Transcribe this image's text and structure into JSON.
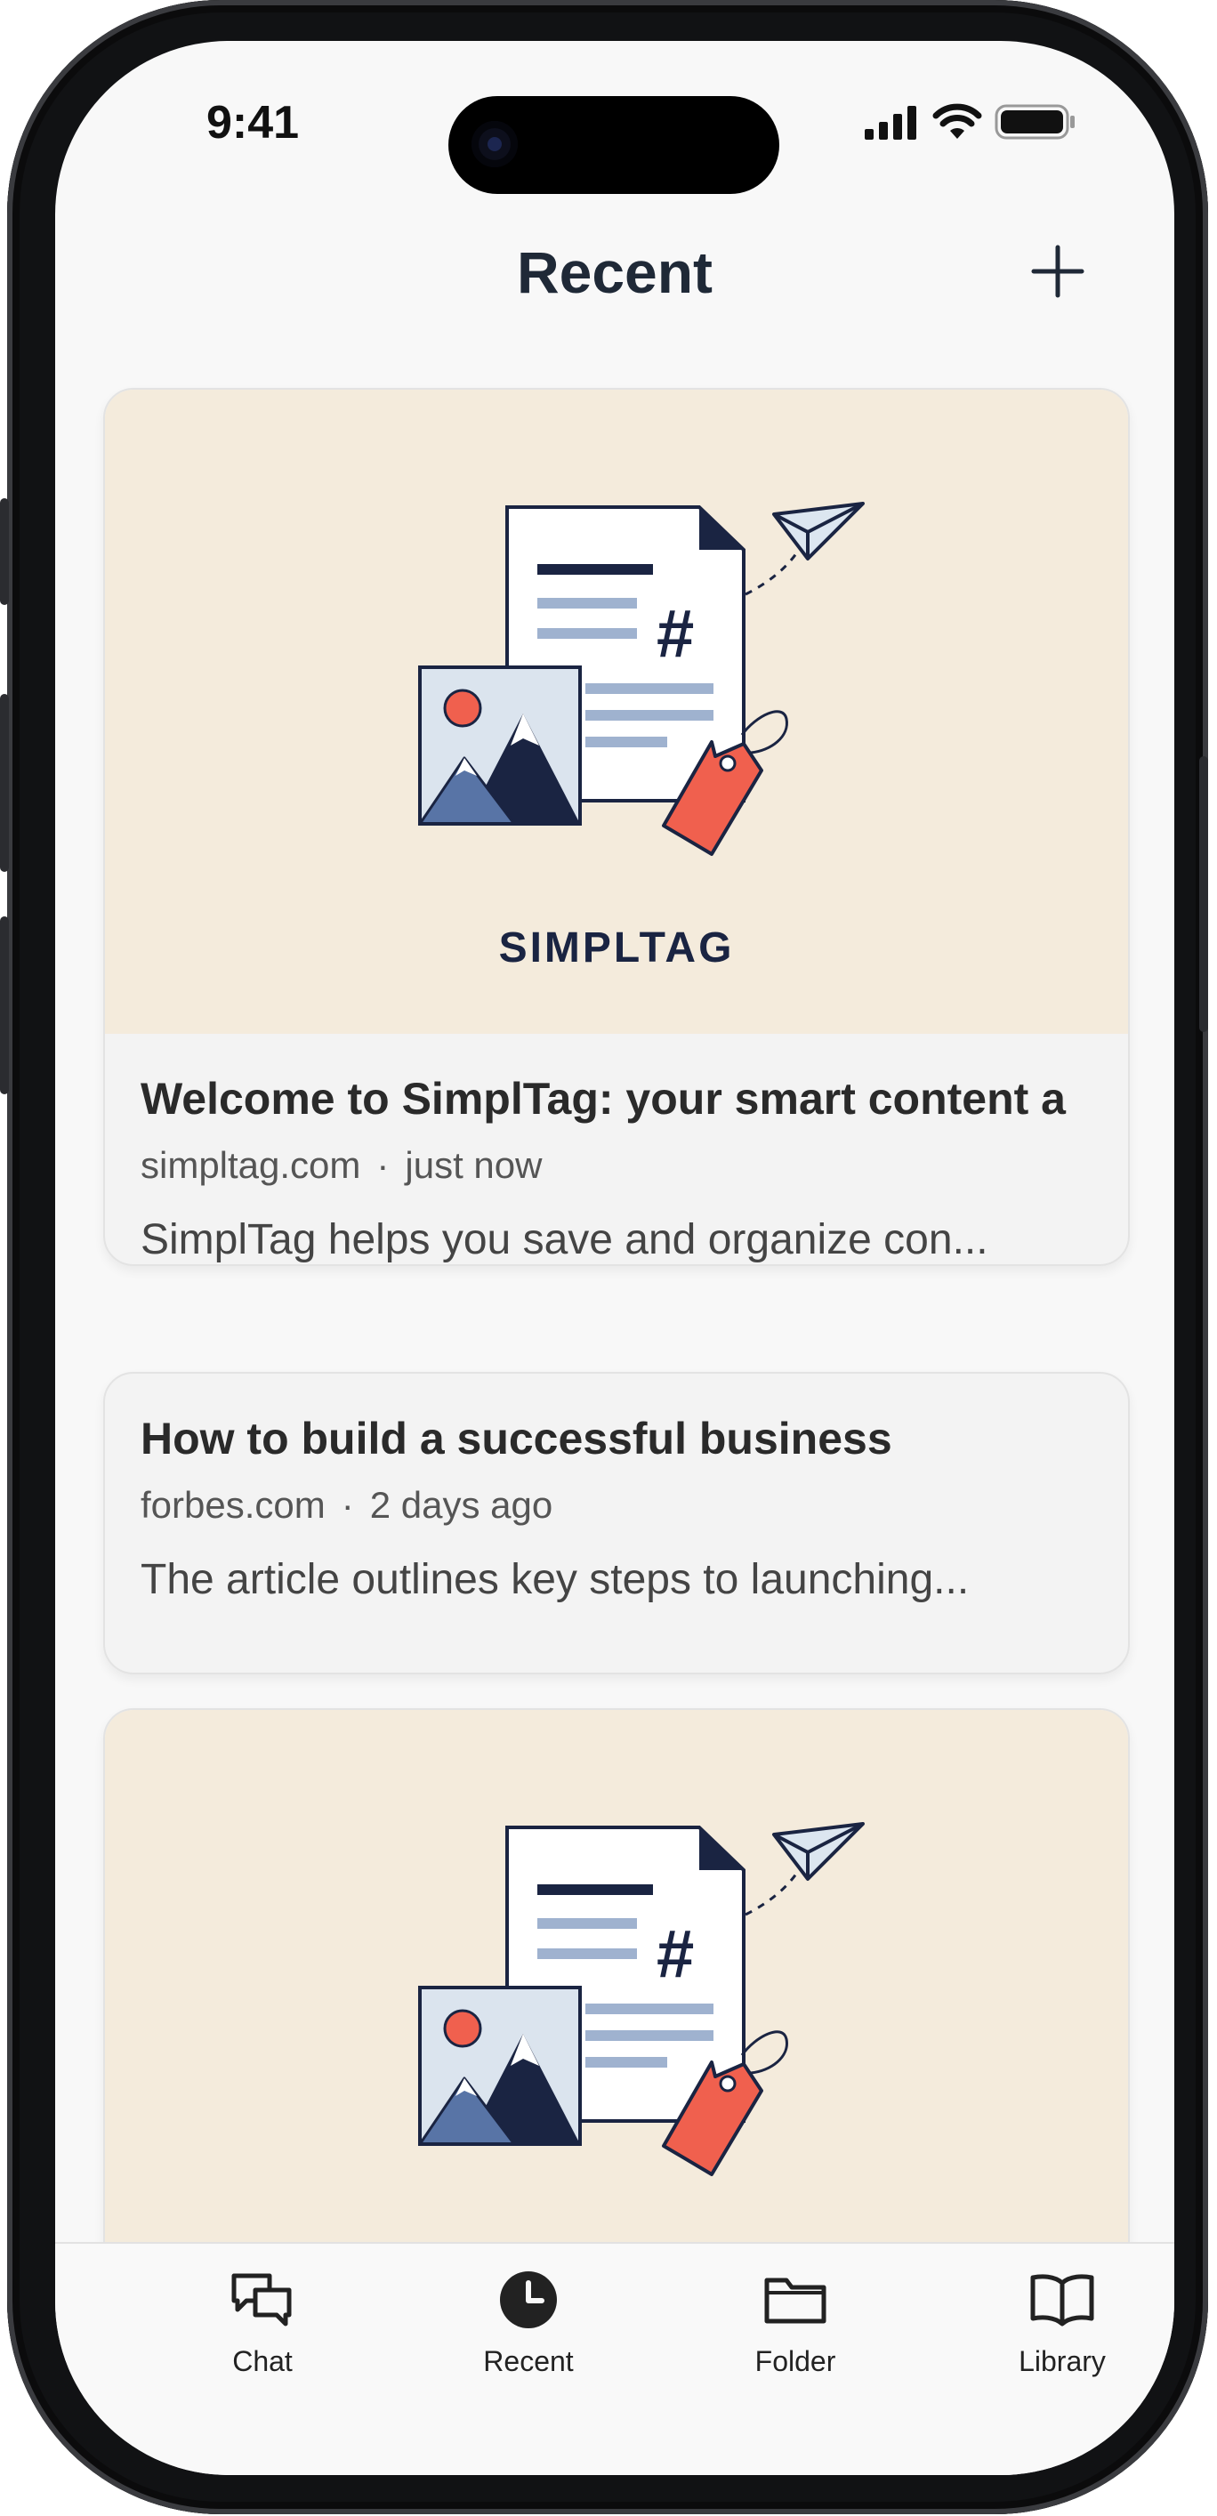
{
  "status_bar": {
    "time": "9:41"
  },
  "header": {
    "title": "Recent",
    "add_icon": "plus-icon"
  },
  "cards": [
    {
      "has_image": true,
      "image_logo_text": "SIMPLTAG",
      "title": "Welcome to SimplTag: your smart content a",
      "source": "simpltag.com",
      "separator": "·",
      "time": "just now",
      "summary": "SimplTag helps you save and organize con..."
    },
    {
      "has_image": false,
      "title": "How to build a successful business",
      "source": "forbes.com",
      "separator": "·",
      "time": "2 days ago",
      "summary": "The article outlines key steps to launching..."
    },
    {
      "has_image": true,
      "image_logo_text": ""
    }
  ],
  "tabbar": {
    "tabs": [
      {
        "label": "Chat",
        "icon": "chat-bubbles-icon",
        "active": false
      },
      {
        "label": "Recent",
        "icon": "clock-icon",
        "active": true
      },
      {
        "label": "Folder",
        "icon": "folder-icon",
        "active": false
      },
      {
        "label": "Library",
        "icon": "book-icon",
        "active": false
      }
    ]
  },
  "colors": {
    "card_image_bg": "#f4ebdc",
    "navy": "#1a2442",
    "tag_red": "#f0604e",
    "steel_blue": "#5874a6"
  }
}
